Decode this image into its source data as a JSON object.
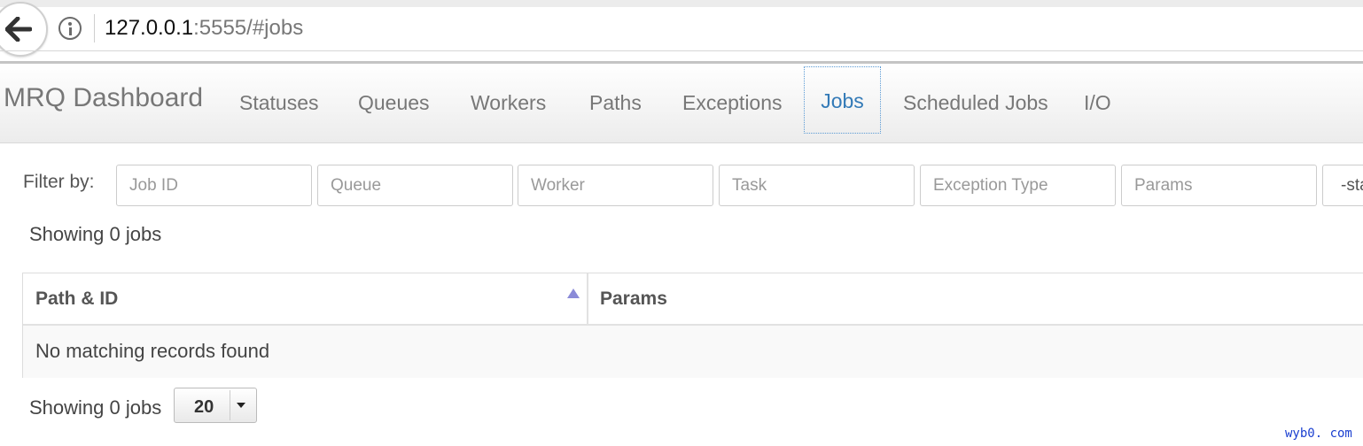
{
  "browser": {
    "url_host": "127.0.0.1",
    "url_rest": ":5555/#jobs",
    "icons": {
      "back": "arrow-left-icon",
      "info": "info-icon"
    }
  },
  "navbar": {
    "brand": "MRQ Dashboard",
    "items": [
      {
        "label": "Statuses",
        "active": false
      },
      {
        "label": "Queues",
        "active": false
      },
      {
        "label": "Workers",
        "active": false
      },
      {
        "label": "Paths",
        "active": false
      },
      {
        "label": "Exceptions",
        "active": false
      },
      {
        "label": "Jobs",
        "active": true
      },
      {
        "label": "Scheduled Jobs",
        "active": false
      },
      {
        "label": "I/O",
        "active": false
      }
    ]
  },
  "filters": {
    "label": "Filter by:",
    "job_id_placeholder": "Job ID",
    "queue_placeholder": "Queue",
    "worker_placeholder": "Worker",
    "task_placeholder": "Task",
    "exception_placeholder": "Exception Type",
    "params_placeholder": "Params",
    "status_value": "-sta"
  },
  "summary_top": "Showing 0 jobs",
  "table": {
    "columns": [
      "Path & ID",
      "Params"
    ],
    "sort_icon": "sort-asc-icon",
    "empty_message": "No matching records found"
  },
  "footer": {
    "summary": "Showing 0 jobs",
    "page_size": "20",
    "caret_icon": "caret-down-icon"
  },
  "watermark": "wyb0. com",
  "colors": {
    "active_nav": "#337ab7",
    "sort_icon": "#8b8bd8",
    "watermark": "#1a3fd0"
  }
}
